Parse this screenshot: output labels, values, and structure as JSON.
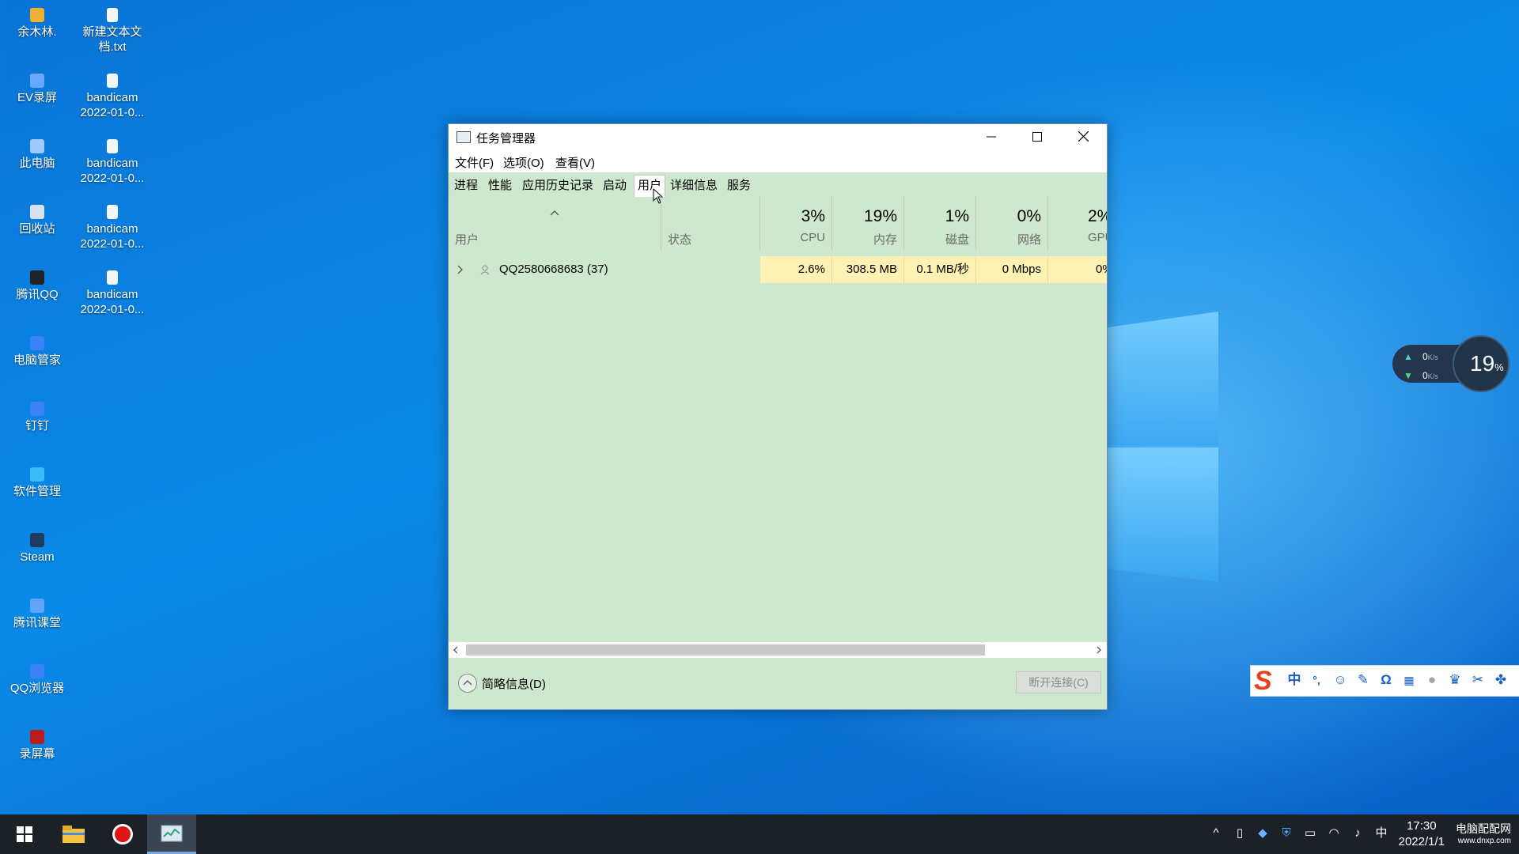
{
  "desktop": {
    "icons_col1": [
      "余木林.",
      "EV录屏",
      "此电脑",
      "回收站",
      "腾讯QQ",
      "电脑管家",
      "钉钉",
      "软件管理",
      "Steam",
      "腾讯课堂",
      "QQ浏览器",
      "录屏幕"
    ],
    "icons_col2": [
      {
        "line1": "新建文本文",
        "line2": "档.txt"
      },
      {
        "line1": "bandicam",
        "line2": "2022-01-0..."
      },
      {
        "line1": "bandicam",
        "line2": "2022-01-0..."
      },
      {
        "line1": "bandicam",
        "line2": "2022-01-0..."
      },
      {
        "line1": "bandicam",
        "line2": "2022-01-0..."
      }
    ]
  },
  "window": {
    "title": "任务管理器",
    "menu": [
      "文件(F)",
      "选项(O)",
      "查看(V)"
    ],
    "tabs": [
      "进程",
      "性能",
      "应用历史记录",
      "启动",
      "用户",
      "详细信息",
      "服务"
    ],
    "active_tab": "用户",
    "columns": {
      "user": "用户",
      "status": "状态",
      "cpu": {
        "pct": "3%",
        "label": "CPU"
      },
      "mem": {
        "pct": "19%",
        "label": "内存"
      },
      "disk": {
        "pct": "1%",
        "label": "磁盘"
      },
      "net": {
        "pct": "0%",
        "label": "网络"
      },
      "gpu": {
        "pct": "2%",
        "label": "GPU"
      }
    },
    "row": {
      "user": "QQ2580668683 (37)",
      "cpu": "2.6%",
      "mem": "308.5 MB",
      "disk": "0.1 MB/秒",
      "net": "0 Mbps",
      "gpu": "0%"
    },
    "footer": {
      "fewer_details": "简略信息(D)",
      "disconnect": "断开连接(C)"
    }
  },
  "speed_widget": {
    "up": "0",
    "down": "0",
    "unit": "K/s",
    "percent": "19",
    "percent_sign": "%"
  },
  "taskbar": {
    "time": "17:30",
    "date": "2022/1/1",
    "ime_lang": "中",
    "watermark_line1": "电脑配配网",
    "watermark_line2": "www.dnxp.com"
  },
  "ime_bar": {
    "logo": "S",
    "lang": "中",
    "punct": "°,"
  },
  "colors": {
    "window_bg": "#cde8ce",
    "highlight_cell": "#fdf1b4",
    "taskbar": "#1c2128",
    "ime_logo": "#e8401c"
  }
}
